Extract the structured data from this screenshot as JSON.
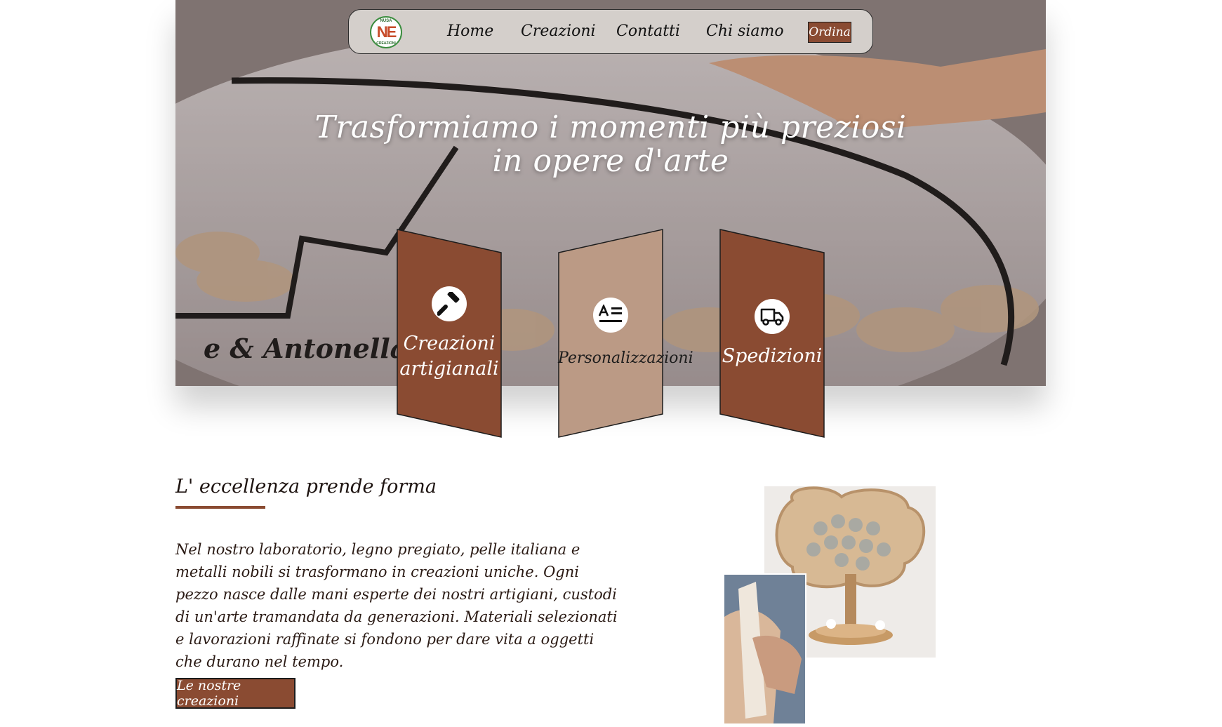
{
  "nav": {
    "logo": {
      "main": "NE",
      "top": "NUSA",
      "bottom": "CREAZIONI"
    },
    "items": [
      {
        "label": "Home"
      },
      {
        "label": "Creazioni"
      },
      {
        "label": "Contatti"
      },
      {
        "label": "Chi siamo"
      }
    ],
    "order_label": "Ordina"
  },
  "hero": {
    "title_line1": "Trasformiamo i momenti più preziosi",
    "title_line2": "in opere d'arte"
  },
  "services": [
    {
      "label_line1": "Creazioni",
      "label_line2": "artigianali",
      "icon": "hammer-icon",
      "color": "#8a4b32"
    },
    {
      "label_line1": "Personalizzazioni",
      "label_line2": "",
      "icon": "text-edit-icon",
      "color": "#bb9a85"
    },
    {
      "label_line1": "Spedizioni",
      "label_line2": "",
      "icon": "truck-icon",
      "color": "#8a4b32"
    }
  ],
  "about": {
    "title": "L' eccellenza prende forma",
    "body": "Nel nostro laboratorio, legno pregiato, pelle italiana e metalli nobili si trasformano in creazioni uniche. Ogni pezzo nasce dalle mani esperte dei nostri artigiani, custodi di un'arte tramandata da generazioni. Materiali selezionati e lavorazioni raffinate si fondono per dare vita a oggetti che durano nel tempo.",
    "cta_label": "Le nostre creazioni"
  },
  "colors": {
    "brand": "#8a4b32",
    "brand_light": "#bb9a85",
    "nav_bg": "#d4cfcb"
  }
}
